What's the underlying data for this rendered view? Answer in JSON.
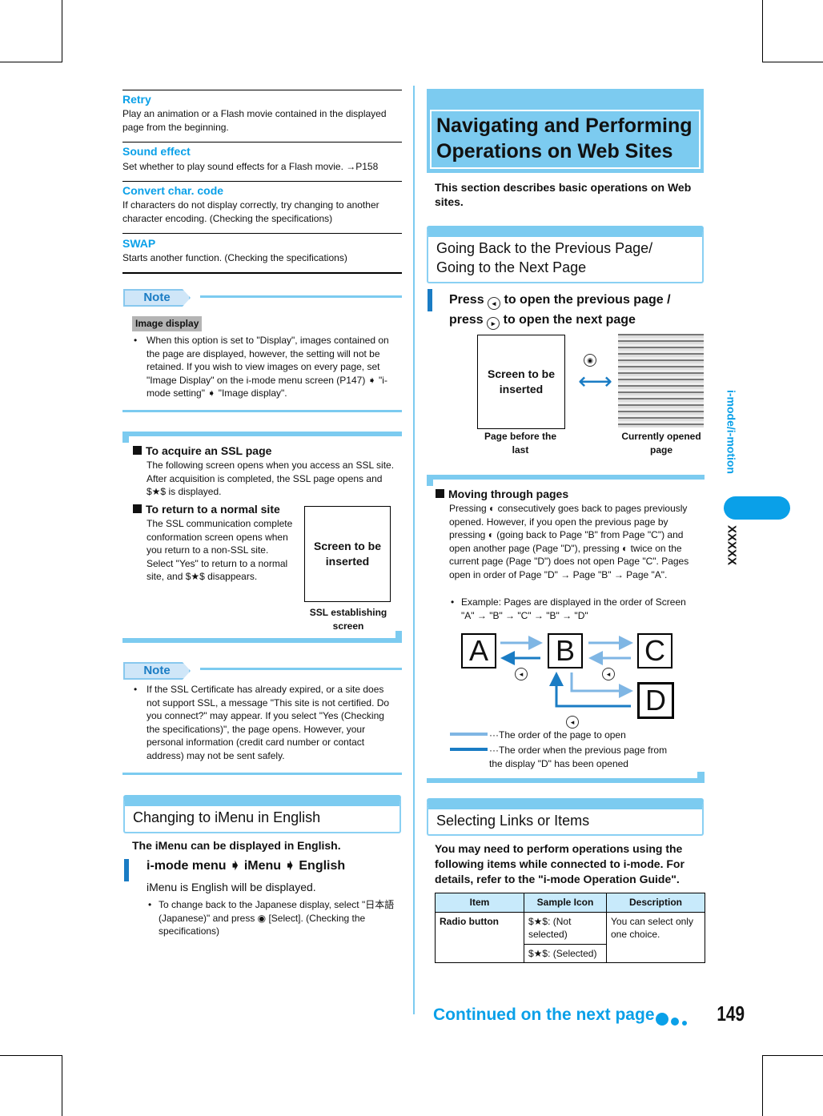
{
  "left": {
    "items": [
      {
        "title": "Retry",
        "desc": "Play an animation or a Flash movie contained in the displayed page from the beginning."
      },
      {
        "title": "Sound effect",
        "desc": "Set whether to play sound effects for a Flash movie. →P158"
      },
      {
        "title": "Convert char. code",
        "desc": "If characters do not display correctly, try changing to another character encoding. (Checking the specifications)"
      },
      {
        "title": "SWAP",
        "desc": "Starts another function. (Checking the specifications)"
      }
    ],
    "note1": {
      "label": "Note",
      "tag": "Image display",
      "text": "When this option is set to \"Display\", images contained on the page are displayed, however, the setting will not be retained. If you wish to view images on every page, set \"Image Display\" on the i-mode menu screen (P147) ➧ \"i-mode setting\" ➧ \"Image display\"."
    },
    "ssl": {
      "acq_title": "To acquire an SSL page",
      "acq_text": "The following screen opens when you access an SSL site. After acquisition is completed, the SSL page opens and $★$ is displayed.",
      "ret_title": "To return to a normal site",
      "ret_text": "The SSL communication complete conformation screen opens when you return to a non-SSL site. Select \"Yes\" to return to a normal site, and $★$ disappears.",
      "screen": "Screen to be inserted",
      "caption": "SSL establishing screen"
    },
    "note2": {
      "label": "Note",
      "text": "If the SSL Certificate has already expired, or a site does not support SSL, a message \"This site is not certified. Do you connect?\" may appear. If you select \"Yes (Checking the specifications)\", the page opens. However, your personal information (credit card number or contact address) may not be sent safely."
    },
    "imenu": {
      "heading": "Changing to iMenu in English",
      "intro": "The iMenu can be displayed in English.",
      "step": "i-mode menu ➧ iMenu ➧ English",
      "result": "iMenu is English will be displayed.",
      "bullet": "To change back to the Japanese display, select \"日本語 (Japanese)\" and press ◉ [Select]. (Checking the specifications)"
    }
  },
  "right": {
    "title": "Navigating and Performing Operations on Web Sites",
    "intro": "This section describes basic operations on Web sites.",
    "back": {
      "heading": "Going Back to the Previous Page/ Going to the Next Page",
      "step_a": "Press",
      "step_b": "to open the previous page /",
      "step_c": "press",
      "step_d": "to open the next page",
      "screen": "Screen to be inserted",
      "cap1": "Page before the last",
      "cap2": "Currently opened page"
    },
    "moving": {
      "title": "Moving through pages",
      "text": "Pressing ◐ consecutively goes back to pages previously opened. However, if you open the previous page by pressing ◐ (going back to Page \"B\" from Page \"C\") and open another page (Page \"D\"), pressing ◐ twice on the current page (Page \"D\") does not open Page \"C\". Pages open in order of Page \"D\" → Page \"B\" → Page \"A\".",
      "example": "Example:  Pages are displayed in the order of Screen \"A\" → \"B\" → \"C\" → \"B\" → \"D\"",
      "letters": [
        "A",
        "B",
        "C",
        "D"
      ],
      "legend1": "···The order of the page to open",
      "legend2": "···The order when the previous page from the display \"D\" has been opened"
    },
    "links": {
      "heading": "Selecting Links or Items",
      "intro": "You may need to perform operations using the following items while connected to i-mode. For details, refer to the \"i-mode Operation Guide\".",
      "table": {
        "headers": [
          "Item",
          "Sample Icon",
          "Description"
        ],
        "item": "Radio button",
        "icon1": "$★$: (Not selected)",
        "icon2": "$★$: (Selected)",
        "desc": "You can select only one choice."
      }
    }
  },
  "sidebar": {
    "section": "i-mode/i-motion",
    "tab": "XXXXX"
  },
  "footer": {
    "continued": "Continued on the next page",
    "page": "149"
  },
  "colors": {
    "accent": "#0aa0e8",
    "band": "#7ccbf0",
    "dark_arrow": "#1a7cc4",
    "light_arrow": "#7fb6e4"
  }
}
